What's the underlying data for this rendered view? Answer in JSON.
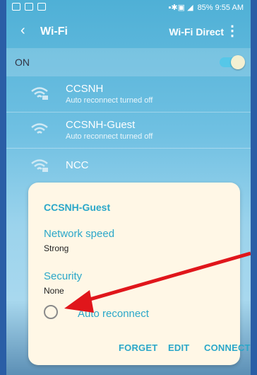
{
  "status_bar": {
    "right_text": "85% 9:55 AM"
  },
  "appbar": {
    "back_symbol": "‹",
    "title": "Wi-Fi",
    "wifi_direct_label": "Wi-Fi Direct",
    "more_symbol": "⋮"
  },
  "onrow": {
    "label": "ON",
    "toggle_state": "on"
  },
  "networks": [
    {
      "name": "CCSNH",
      "subtitle": "Auto reconnect turned off",
      "icon": "wifi-locked-icon"
    },
    {
      "name": "CCSNH-Guest",
      "subtitle": "Auto reconnect turned off",
      "icon": "wifi-icon"
    },
    {
      "name": "NCC",
      "subtitle": "",
      "icon": "wifi-locked-icon"
    }
  ],
  "dialog": {
    "title": "CCSNH-Guest",
    "network_speed_label": "Network speed",
    "network_speed_value": "Strong",
    "security_label": "Security",
    "security_value": "None",
    "auto_reconnect_label": "Auto reconnect",
    "auto_reconnect_checked": false,
    "buttons": {
      "forget": "FORGET",
      "edit": "EDIT",
      "connect": "CONNECT"
    }
  },
  "colors": {
    "accent": "#2aa7c9",
    "annotation_arrow": "#e0161b",
    "page_border": "#2a5ea6"
  }
}
